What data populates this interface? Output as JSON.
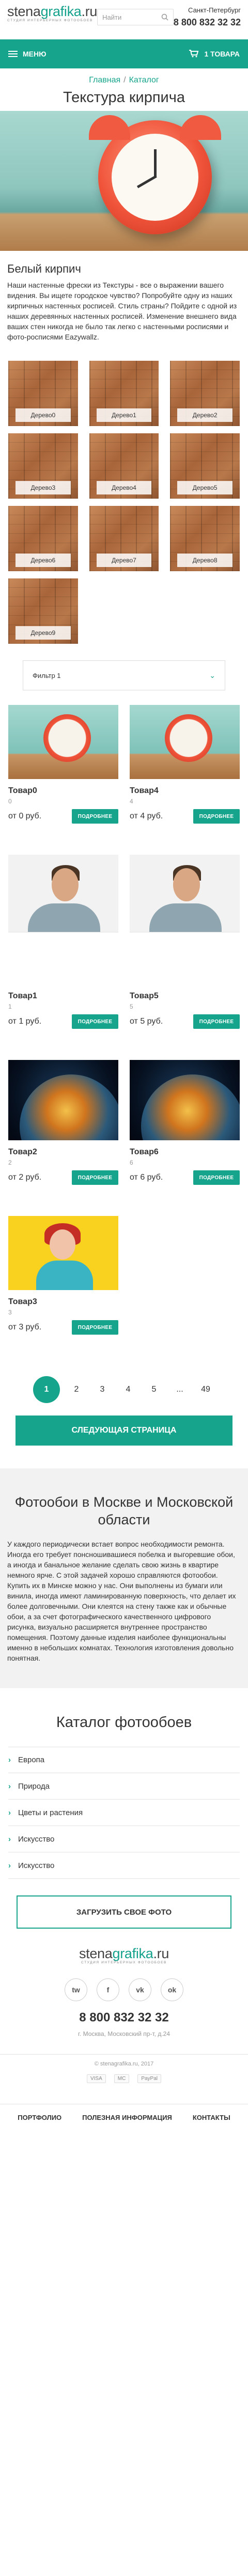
{
  "header": {
    "logo_main": "stena",
    "logo_accent": "grafika",
    "logo_suffix": ".ru",
    "logo_tagline": "студия интерьерных фотообоев",
    "search_placeholder": "Найти",
    "city": "Санкт-Петербург",
    "phone": "8 800 832 32 32"
  },
  "nav": {
    "menu_label": "МЕНЮ",
    "cart_label": "1 ТОВАРА"
  },
  "breadcrumb": {
    "home": "Главная",
    "sep": "/",
    "catalog": "Каталог"
  },
  "page_title": "Текстура кирпича",
  "section_title": "Белый кирпич",
  "intro": "Наши настенные фрески из Текстуры - все о выражении вашего видения. Вы ищете городское чувство? Попробуйте одну из наших кирпичных настенных росписей. Стиль страны? Пойдите с одной из наших деревянных настенных росписей. Изменение внешнего вида ваших стен никогда не было так легко с настенными росписями и фото-росписями Eazywallz.",
  "walls": [
    "Дерево0",
    "Дерево1",
    "Дерево2",
    "Дерево3",
    "Дерево4",
    "Дерево5",
    "Дерево6",
    "Дерево7",
    "Дерево8",
    "Дерево9"
  ],
  "filter": {
    "label": "Фильтр 1",
    "icon": "chevron-down-icon"
  },
  "products": [
    {
      "name": "Товар0",
      "num": "0",
      "price": "от 0 руб.",
      "btn": "ПОДРОБНЕЕ",
      "img": "clock"
    },
    {
      "name": "Товар4",
      "num": "4",
      "price": "от 4 руб.",
      "btn": "ПОДРОБНЕЕ",
      "img": "clock"
    },
    {
      "name": "Товар1",
      "num": "1",
      "price": "от 1 руб.",
      "btn": "ПОДРОБНЕЕ",
      "img": "man"
    },
    {
      "name": "Товар5",
      "num": "5",
      "price": "от 5 руб.",
      "btn": "ПОДРОБНЕЕ",
      "img": "man"
    },
    {
      "name": "Товар2",
      "num": "2",
      "price": "от 2 руб.",
      "btn": "ПОДРОБНЕЕ",
      "img": "earth"
    },
    {
      "name": "Товар6",
      "num": "6",
      "price": "от 6 руб.",
      "btn": "ПОДРОБНЕЕ",
      "img": "earth"
    },
    {
      "name": "Товар3",
      "num": "3",
      "price": "от 3 руб.",
      "btn": "ПОДРОБНЕЕ",
      "img": "woman"
    }
  ],
  "pagination": {
    "pages": [
      "1",
      "2",
      "3",
      "4",
      "5",
      "...",
      "49"
    ],
    "active": "1"
  },
  "next_page": "СЛЕДУЮЩАЯ СТРАНИЦА",
  "about": {
    "title": "Фотообои в Москве и Московской области",
    "text": "У каждого периодически встает вопрос необходимости ремонта. Иногда его требует понсношивашиеся побелка и выгоревшие обои, а иногда и банальное желание сделать свою жизнь в квартире немного ярче. С этой задачей хорошо справляются фотообои. Купить их в Минске можно у нас. Они выполнены из бумаги или винила, иногда имеют ламинированную поверхность, что делает их более долговечными. Они клеятся на стену также как и обычные обои, а за счет фотографического качественного цифрового рисунка, визуально расширяется внутреннее пространство помещения. Поэтому данные изделия наиболее функциональны именно в небольших комнатах. Технология изготовления довольно понятная."
  },
  "catalog": {
    "title": "Каталог фотообоев",
    "items": [
      "Европа",
      "Природа",
      "Цветы и растения",
      "Искусство",
      "Искусство"
    ]
  },
  "upload_btn": "ЗАГРУЗИТЬ СВОЕ ФОТО",
  "footer": {
    "socials": [
      "tw",
      "f",
      "vk",
      "ok"
    ],
    "phone": "8 800 832 32 32",
    "address": "г. Москва, Московский пр-т, д.24",
    "copyright": "© stenagrafika.ru, 2017",
    "payments": [
      "VISA",
      "MC",
      "PayPal"
    ],
    "nav": [
      "ПОРТФОЛИО",
      "ПОЛЕЗНАЯ ИНФОРМАЦИЯ",
      "КОНТАКТЫ"
    ]
  },
  "colors": {
    "accent": "#16a58c",
    "text": "#333333",
    "muted": "#999999"
  }
}
